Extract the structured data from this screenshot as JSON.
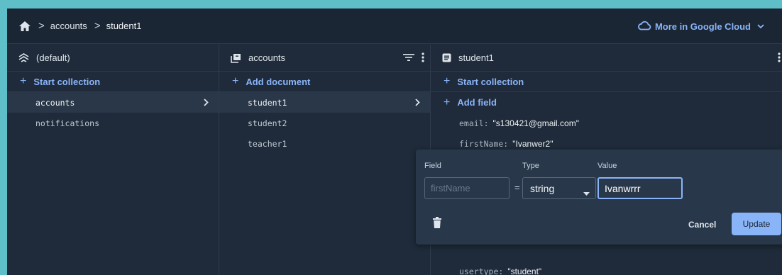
{
  "breadcrumb": {
    "sep": ">",
    "items": [
      "accounts",
      "student1"
    ]
  },
  "header": {
    "cloud_link": "More in Google Cloud"
  },
  "col_default": {
    "title": "(default)",
    "action": "Start collection",
    "items": [
      "accounts",
      "notifications"
    ],
    "selected": "accounts"
  },
  "col_accounts": {
    "title": "accounts",
    "action": "Add document",
    "items": [
      "student1",
      "student2",
      "teacher1"
    ],
    "selected": "student1"
  },
  "col_document": {
    "title": "student1",
    "action_start": "Start collection",
    "action_add": "Add field",
    "fields": [
      {
        "key": "email:",
        "value": "\"s130421@gmail.com\""
      },
      {
        "key": "firstName:",
        "value": "\"Ivanwer2\""
      },
      {
        "key": "usertype:",
        "value": "\"student\""
      }
    ]
  },
  "editor": {
    "label_field": "Field",
    "label_type": "Type",
    "label_value": "Value",
    "field_placeholder": "firstName",
    "equals": "=",
    "type_value": "string",
    "value": "Ivanwrrr",
    "cancel": "Cancel",
    "update": "Update"
  },
  "colors": {
    "accent": "#8ab4f8",
    "background": "#1f2b3a",
    "outer": "#5fbfc8"
  }
}
